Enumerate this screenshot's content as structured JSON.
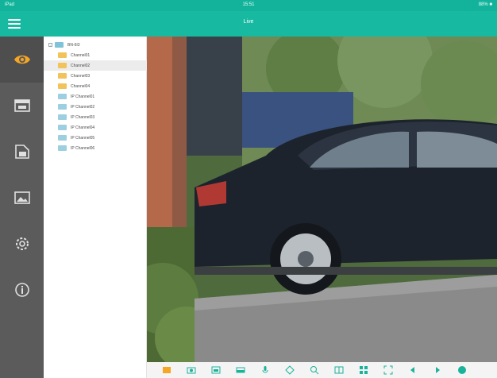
{
  "status_bar": {
    "carrier": "iPad",
    "time": "15:51",
    "indicators": "88% ■"
  },
  "header": {
    "title": "Live",
    "menu_icon": "hamburger-icon"
  },
  "rail": {
    "items": [
      {
        "icon": "eye-icon",
        "active": true
      },
      {
        "icon": "playback-icon",
        "active": false
      },
      {
        "icon": "file-manager-icon",
        "active": false
      },
      {
        "icon": "image-icon",
        "active": false
      },
      {
        "icon": "settings-gear-icon",
        "active": false
      },
      {
        "icon": "info-icon",
        "active": false
      }
    ],
    "active_color": "#f5a623"
  },
  "tree": {
    "device": "BN-6I3",
    "channels": [
      {
        "label": "Channel01",
        "type": "channel"
      },
      {
        "label": "Channel02",
        "type": "channel",
        "selected": true
      },
      {
        "label": "Channel03",
        "type": "channel"
      },
      {
        "label": "Channel04",
        "type": "channel"
      },
      {
        "label": "IP Channel01",
        "type": "ip"
      },
      {
        "label": "IP Channel02",
        "type": "ip"
      },
      {
        "label": "IP Channel03",
        "type": "ip"
      },
      {
        "label": "IP Channel04",
        "type": "ip"
      },
      {
        "label": "IP Channel05",
        "type": "ip"
      },
      {
        "label": "IP Channel06",
        "type": "ip"
      }
    ]
  },
  "toolbar": {
    "buttons": [
      "stop-all-icon",
      "snapshot-icon",
      "record-icon",
      "talk-icon",
      "audio-icon",
      "ptz-icon",
      "zoom-icon",
      "quality-icon",
      "layout-icon",
      "fullscreen-icon",
      "prev-icon",
      "next-icon",
      "favorite-icon"
    ],
    "accent": "#f5a623"
  }
}
